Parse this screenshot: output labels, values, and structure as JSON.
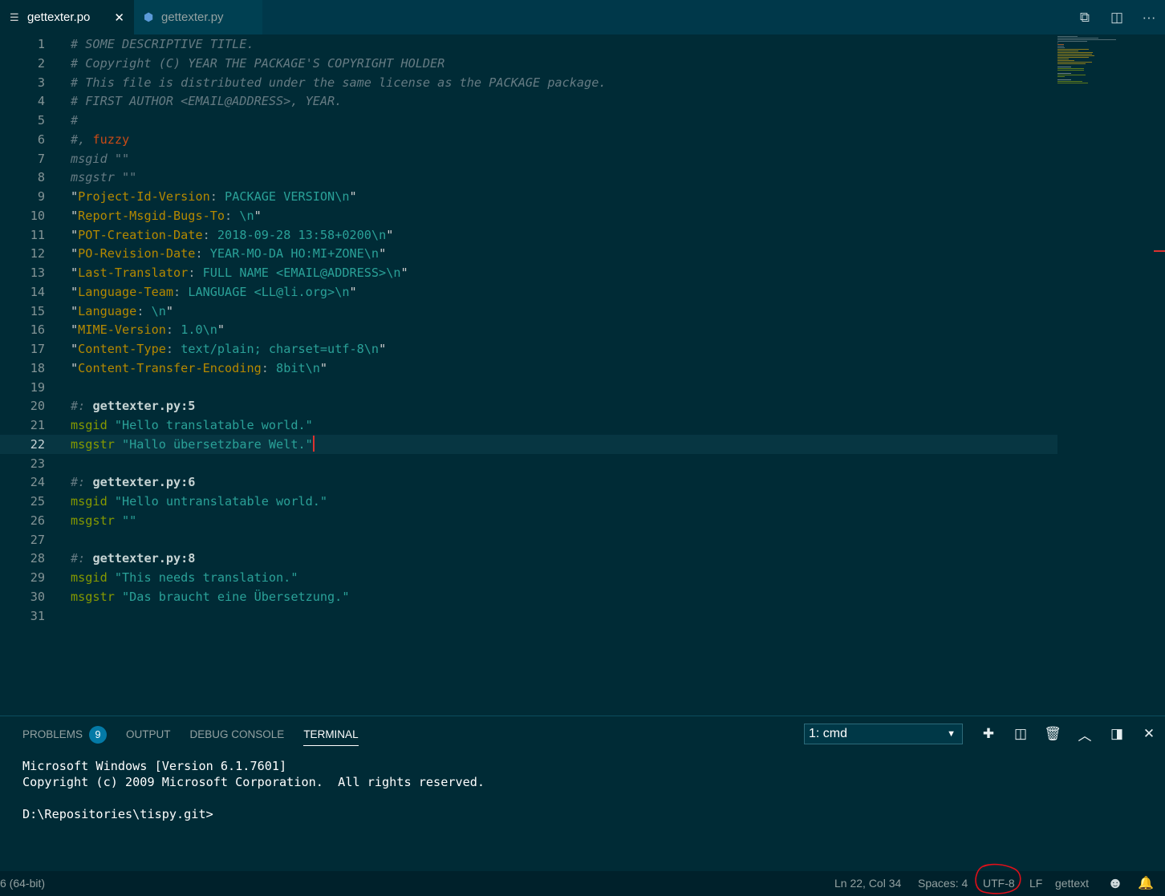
{
  "tabs": [
    {
      "label": "gettexter.po",
      "icon": "lines-file-icon",
      "active": true,
      "close": "✕"
    },
    {
      "label": "gettexter.py",
      "icon": "python-icon",
      "active": false
    }
  ],
  "tab_actions": [
    {
      "name": "open-changes-icon",
      "glyph": "⧉"
    },
    {
      "name": "split-editor-icon",
      "glyph": "◫"
    },
    {
      "name": "more-actions-icon",
      "glyph": "···"
    }
  ],
  "editor": {
    "current_line": 22,
    "lines": [
      {
        "n": "1",
        "parts": [
          {
            "t": "# SOME DESCRIPTIVE TITLE.",
            "c": "c-comment"
          }
        ]
      },
      {
        "n": "2",
        "parts": [
          {
            "t": "# Copyright (C) YEAR THE PACKAGE'S COPYRIGHT HOLDER",
            "c": "c-comment"
          }
        ]
      },
      {
        "n": "3",
        "parts": [
          {
            "t": "# This file is distributed under the same license as the PACKAGE package.",
            "c": "c-comment"
          }
        ]
      },
      {
        "n": "4",
        "parts": [
          {
            "t": "# FIRST AUTHOR <EMAIL@ADDRESS>, YEAR.",
            "c": "c-comment"
          }
        ]
      },
      {
        "n": "5",
        "parts": [
          {
            "t": "#",
            "c": "c-comment"
          }
        ]
      },
      {
        "n": "6",
        "parts": [
          {
            "t": "#, ",
            "c": "c-comment"
          },
          {
            "t": "fuzzy",
            "c": "c-flag"
          }
        ]
      },
      {
        "n": "7",
        "parts": [
          {
            "t": "msgid \"\"",
            "c": "c-comment"
          }
        ]
      },
      {
        "n": "8",
        "parts": [
          {
            "t": "msgstr \"\"",
            "c": "c-comment"
          }
        ]
      },
      {
        "n": "9",
        "parts": [
          {
            "t": "\"",
            "c": "c-quote"
          },
          {
            "t": "Project-Id-Version",
            "c": "c-hdr"
          },
          {
            "t": ": ",
            "c": "c-white"
          },
          {
            "t": "PACKAGE VERSION\\n",
            "c": "c-val"
          },
          {
            "t": "\"",
            "c": "c-quote"
          }
        ]
      },
      {
        "n": "10",
        "parts": [
          {
            "t": "\"",
            "c": "c-quote"
          },
          {
            "t": "Report-Msgid-Bugs-To",
            "c": "c-hdr"
          },
          {
            "t": ": ",
            "c": "c-white"
          },
          {
            "t": "\\n",
            "c": "c-val"
          },
          {
            "t": "\"",
            "c": "c-quote"
          }
        ]
      },
      {
        "n": "11",
        "parts": [
          {
            "t": "\"",
            "c": "c-quote"
          },
          {
            "t": "POT-Creation-Date",
            "c": "c-hdr"
          },
          {
            "t": ": ",
            "c": "c-white"
          },
          {
            "t": "2018-09-28 13:58+0200\\n",
            "c": "c-val"
          },
          {
            "t": "\"",
            "c": "c-quote"
          }
        ]
      },
      {
        "n": "12",
        "parts": [
          {
            "t": "\"",
            "c": "c-quote"
          },
          {
            "t": "PO-Revision-Date",
            "c": "c-hdr"
          },
          {
            "t": ": ",
            "c": "c-white"
          },
          {
            "t": "YEAR-MO-DA HO:MI+ZONE\\n",
            "c": "c-val"
          },
          {
            "t": "\"",
            "c": "c-quote"
          }
        ]
      },
      {
        "n": "13",
        "parts": [
          {
            "t": "\"",
            "c": "c-quote"
          },
          {
            "t": "Last-Translator",
            "c": "c-hdr"
          },
          {
            "t": ": ",
            "c": "c-white"
          },
          {
            "t": "FULL NAME <EMAIL@ADDRESS>\\n",
            "c": "c-val"
          },
          {
            "t": "\"",
            "c": "c-quote"
          }
        ]
      },
      {
        "n": "14",
        "parts": [
          {
            "t": "\"",
            "c": "c-quote"
          },
          {
            "t": "Language-Team",
            "c": "c-hdr"
          },
          {
            "t": ": ",
            "c": "c-white"
          },
          {
            "t": "LANGUAGE <LL@li.org>\\n",
            "c": "c-val"
          },
          {
            "t": "\"",
            "c": "c-quote"
          }
        ]
      },
      {
        "n": "15",
        "parts": [
          {
            "t": "\"",
            "c": "c-quote"
          },
          {
            "t": "Language",
            "c": "c-hdr"
          },
          {
            "t": ": ",
            "c": "c-white"
          },
          {
            "t": "\\n",
            "c": "c-val"
          },
          {
            "t": "\"",
            "c": "c-quote"
          }
        ]
      },
      {
        "n": "16",
        "parts": [
          {
            "t": "\"",
            "c": "c-quote"
          },
          {
            "t": "MIME-Version",
            "c": "c-hdr"
          },
          {
            "t": ": ",
            "c": "c-white"
          },
          {
            "t": "1.0\\n",
            "c": "c-val"
          },
          {
            "t": "\"",
            "c": "c-quote"
          }
        ]
      },
      {
        "n": "17",
        "parts": [
          {
            "t": "\"",
            "c": "c-quote"
          },
          {
            "t": "Content-Type",
            "c": "c-hdr"
          },
          {
            "t": ": ",
            "c": "c-white"
          },
          {
            "t": "text/plain; charset=utf-8\\n",
            "c": "c-val"
          },
          {
            "t": "\"",
            "c": "c-quote"
          }
        ]
      },
      {
        "n": "18",
        "parts": [
          {
            "t": "\"",
            "c": "c-quote"
          },
          {
            "t": "Content-Transfer-Encoding",
            "c": "c-hdr"
          },
          {
            "t": ": ",
            "c": "c-white"
          },
          {
            "t": "8bit\\n",
            "c": "c-val"
          },
          {
            "t": "\"",
            "c": "c-quote"
          }
        ]
      },
      {
        "n": "19",
        "parts": []
      },
      {
        "n": "20",
        "parts": [
          {
            "t": "#: ",
            "c": "c-comment"
          },
          {
            "t": "gettexter.py:5",
            "c": "c-ref"
          }
        ]
      },
      {
        "n": "21",
        "parts": [
          {
            "t": "msgid ",
            "c": "c-key"
          },
          {
            "t": "\"Hello translatable world.\"",
            "c": "c-str"
          }
        ]
      },
      {
        "n": "22",
        "parts": [
          {
            "t": "msgstr ",
            "c": "c-key"
          },
          {
            "t": "\"Hallo übersetzbare Welt.\"",
            "c": "c-str"
          }
        ],
        "cursor": true
      },
      {
        "n": "23",
        "parts": []
      },
      {
        "n": "24",
        "parts": [
          {
            "t": "#: ",
            "c": "c-comment"
          },
          {
            "t": "gettexter.py:6",
            "c": "c-ref"
          }
        ]
      },
      {
        "n": "25",
        "parts": [
          {
            "t": "msgid ",
            "c": "c-key"
          },
          {
            "t": "\"Hello untranslatable world.\"",
            "c": "c-str"
          }
        ]
      },
      {
        "n": "26",
        "parts": [
          {
            "t": "msgstr ",
            "c": "c-key"
          },
          {
            "t": "\"\"",
            "c": "c-str"
          }
        ]
      },
      {
        "n": "27",
        "parts": []
      },
      {
        "n": "28",
        "parts": [
          {
            "t": "#: ",
            "c": "c-comment"
          },
          {
            "t": "gettexter.py:8",
            "c": "c-ref"
          }
        ]
      },
      {
        "n": "29",
        "parts": [
          {
            "t": "msgid ",
            "c": "c-key"
          },
          {
            "t": "\"This needs translation.\"",
            "c": "c-str"
          }
        ]
      },
      {
        "n": "30",
        "parts": [
          {
            "t": "msgstr ",
            "c": "c-key"
          },
          {
            "t": "\"Das braucht eine Übersetzung.\"",
            "c": "c-str"
          }
        ]
      },
      {
        "n": "31",
        "parts": []
      }
    ]
  },
  "panel": {
    "tabs": [
      {
        "label": "PROBLEMS",
        "badge": "9"
      },
      {
        "label": "OUTPUT"
      },
      {
        "label": "DEBUG CONSOLE"
      },
      {
        "label": "TERMINAL",
        "active": true
      }
    ],
    "terminal_select": "1: cmd",
    "select_arrow": "▼",
    "actions": [
      {
        "name": "new-terminal-icon",
        "glyph": "✚"
      },
      {
        "name": "split-terminal-icon",
        "glyph": "◫"
      },
      {
        "name": "trash-icon",
        "glyph": "🗑"
      },
      {
        "name": "chevron-up-icon",
        "glyph": "︿"
      },
      {
        "name": "maximize-panel-icon",
        "glyph": "◨"
      },
      {
        "name": "close-panel-icon",
        "glyph": "✕"
      }
    ],
    "terminal_lines": [
      "Microsoft Windows [Version 6.1.7601]",
      "Copyright (c) 2009 Microsoft Corporation.  All rights reserved.",
      "",
      "D:\\Repositories\\tispy.git>"
    ]
  },
  "statusbar": {
    "left": "6 (64-bit)",
    "position": "Ln 22, Col 34",
    "spaces": "Spaces: 4",
    "encoding": "UTF-8",
    "eol": "LF",
    "language": "gettext",
    "feedback_icon": "smiley-icon",
    "notifications_icon": "bell-icon"
  },
  "colors": {
    "background": "#002b36",
    "accent_badge": "#047aa6",
    "annotation": "#e0101a",
    "cursor": "#dc322f"
  }
}
